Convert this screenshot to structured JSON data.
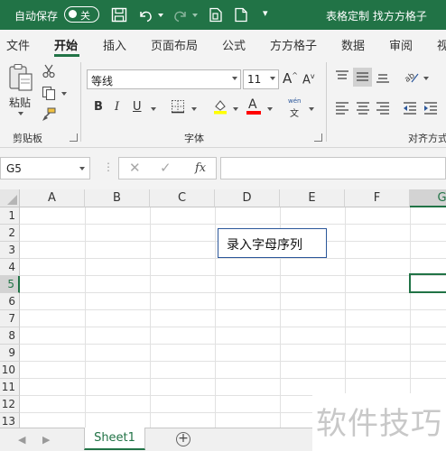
{
  "titlebar": {
    "autosave_label": "自动保存",
    "toggle_state": "关",
    "doc_title": "表格定制 找方方格子",
    "more_glyph": "▾"
  },
  "tabs": [
    "文件",
    "开始",
    "插入",
    "页面布局",
    "公式",
    "方方格子",
    "数据",
    "审阅",
    "视"
  ],
  "active_tab": "开始",
  "ribbon": {
    "paste_label": "粘贴",
    "clipboard_group": "剪贴板",
    "font_name": "等线",
    "font_size": "11",
    "grow_font": "A",
    "shrink_font": "A",
    "bold": "B",
    "italic": "I",
    "underline": "U",
    "font_color_letter": "A",
    "phonetic_top": "wén",
    "phonetic_bottom": "文",
    "font_group": "字体",
    "align_group": "对齐方式"
  },
  "formula_bar": {
    "name_box": "G5",
    "fx": "fx",
    "formula": ""
  },
  "columns": [
    "A",
    "B",
    "C",
    "D",
    "E",
    "F",
    "G"
  ],
  "selected_column": "G",
  "rows": [
    "1",
    "2",
    "3",
    "4",
    "5",
    "6",
    "7",
    "8",
    "9",
    "10",
    "11",
    "12",
    "13"
  ],
  "selected_row": "5",
  "textbox_text": "录入字母序列",
  "sheets": [
    "Sheet1"
  ],
  "add_sheet": "+",
  "watermark": "软件技巧",
  "colors": {
    "accent": "#217346",
    "highlight_yellow": "#ffff00",
    "font_red": "#ff0000",
    "textbox_border": "#2b579a"
  }
}
